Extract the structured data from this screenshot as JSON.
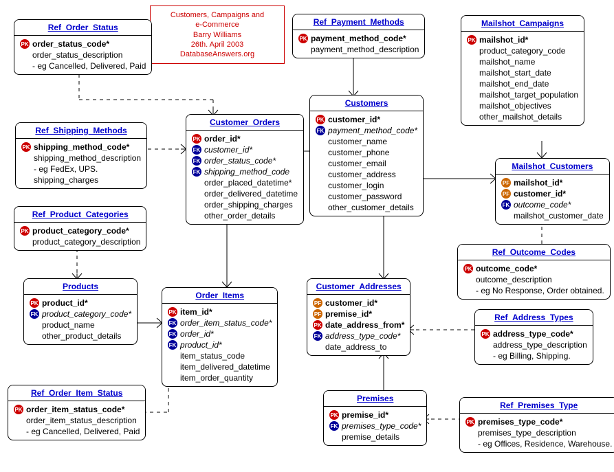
{
  "title": {
    "line1": "Customers, Campaigns and",
    "line2": "e-Commerce",
    "line3": "Barry Williams",
    "line4": "26th. April 2003",
    "line5": "DatabaseAnswers.org"
  },
  "entities": {
    "ref_order_status": {
      "name": "Ref_Order_Status",
      "fields": [
        {
          "key": "pk",
          "name": "order_status_code*",
          "b": true
        },
        {
          "key": "",
          "name": "order_status_description"
        },
        {
          "key": "",
          "name": "- eg Cancelled, Delivered, Paid"
        }
      ]
    },
    "ref_payment_methods": {
      "name": "Ref_Payment_Methods",
      "fields": [
        {
          "key": "pk",
          "name": "payment_method_code*",
          "b": true
        },
        {
          "key": "",
          "name": "payment_method_description"
        }
      ]
    },
    "mailshot_campaigns": {
      "name": "Mailshot_Campaigns",
      "fields": [
        {
          "key": "pk",
          "name": "mailshot_id*",
          "b": true
        },
        {
          "key": "",
          "name": "product_category_code"
        },
        {
          "key": "",
          "name": "mailshot_name"
        },
        {
          "key": "",
          "name": "mailshot_start_date"
        },
        {
          "key": "",
          "name": "mailshot_end_date"
        },
        {
          "key": "",
          "name": "mailshot_target_population"
        },
        {
          "key": "",
          "name": "mailshot_objectives"
        },
        {
          "key": "",
          "name": "other_mailshot_details"
        }
      ]
    },
    "ref_shipping_methods": {
      "name": "Ref_Shipping_Methods",
      "fields": [
        {
          "key": "pk",
          "name": "shipping_method_code*",
          "b": true
        },
        {
          "key": "",
          "name": "shipping_method_description"
        },
        {
          "key": "",
          "name": "- eg FedEx, UPS."
        },
        {
          "key": "",
          "name": "shipping_charges"
        }
      ]
    },
    "customer_orders": {
      "name": "Customer_Orders",
      "fields": [
        {
          "key": "pk",
          "name": "order_id*",
          "b": true
        },
        {
          "key": "fk",
          "name": "customer_id*",
          "i": true
        },
        {
          "key": "fk",
          "name": "order_status_code*",
          "i": true
        },
        {
          "key": "fk",
          "name": "shipping_method_code",
          "i": true
        },
        {
          "key": "",
          "name": "order_placed_datetime*"
        },
        {
          "key": "",
          "name": "order_delivered_datetime"
        },
        {
          "key": "",
          "name": "order_shipping_charges"
        },
        {
          "key": "",
          "name": "other_order_details"
        }
      ]
    },
    "customers": {
      "name": "Customers",
      "fields": [
        {
          "key": "pk",
          "name": "customer_id*",
          "b": true
        },
        {
          "key": "fk",
          "name": "payment_method_code*",
          "i": true
        },
        {
          "key": "",
          "name": "customer_name"
        },
        {
          "key": "",
          "name": "customer_phone"
        },
        {
          "key": "",
          "name": "customer_email"
        },
        {
          "key": "",
          "name": "customer_address"
        },
        {
          "key": "",
          "name": "customer_login"
        },
        {
          "key": "",
          "name": "customer_password"
        },
        {
          "key": "",
          "name": "other_customer_details"
        }
      ]
    },
    "mailshot_customers": {
      "name": "Mailshot_Customers",
      "fields": [
        {
          "key": "pfk",
          "name": "mailshot_id*",
          "b": true
        },
        {
          "key": "pfk",
          "name": "customer_id*",
          "b": true
        },
        {
          "key": "fk",
          "name": "outcome_code*",
          "i": true
        },
        {
          "key": "",
          "name": "mailshot_customer_date"
        }
      ]
    },
    "ref_product_categories": {
      "name": "Ref_Product_Categories",
      "fields": [
        {
          "key": "pk",
          "name": "product_category_code*",
          "b": true
        },
        {
          "key": "",
          "name": "product_category_description"
        }
      ]
    },
    "ref_outcome_codes": {
      "name": "Ref_Outcome_Codes",
      "fields": [
        {
          "key": "pk",
          "name": "outcome_code*",
          "b": true
        },
        {
          "key": "",
          "name": "outcome_description"
        },
        {
          "key": "",
          "name": "- eg No Response, Order obtained."
        }
      ]
    },
    "products": {
      "name": "Products",
      "fields": [
        {
          "key": "pk",
          "name": "product_id*",
          "b": true
        },
        {
          "key": "fk",
          "name": "product_category_code*",
          "i": true
        },
        {
          "key": "",
          "name": "product_name"
        },
        {
          "key": "",
          "name": "other_product_details"
        }
      ]
    },
    "order_items": {
      "name": "Order_Items",
      "fields": [
        {
          "key": "pk",
          "name": "item_id*",
          "b": true
        },
        {
          "key": "fk",
          "name": "order_item_status_code*",
          "i": true
        },
        {
          "key": "fk",
          "name": "order_id*",
          "i": true
        },
        {
          "key": "fk",
          "name": "product_id*",
          "i": true
        },
        {
          "key": "",
          "name": "item_status_code"
        },
        {
          "key": "",
          "name": "item_delivered_datetime"
        },
        {
          "key": "",
          "name": "item_order_quantity"
        }
      ]
    },
    "customer_addresses": {
      "name": "Customer_Addresses",
      "fields": [
        {
          "key": "pfk",
          "name": "customer_id*",
          "b": true
        },
        {
          "key": "pfk",
          "name": "premise_id*",
          "b": true
        },
        {
          "key": "pk",
          "name": "date_address_from*",
          "b": true
        },
        {
          "key": "fk",
          "name": "address_type_code*",
          "i": true
        },
        {
          "key": "",
          "name": "date_address_to"
        }
      ]
    },
    "ref_address_types": {
      "name": "Ref_Address_Types",
      "fields": [
        {
          "key": "pk",
          "name": "address_type_code*",
          "b": true
        },
        {
          "key": "",
          "name": "address_type_description"
        },
        {
          "key": "",
          "name": "- eg Billing, Shipping."
        }
      ]
    },
    "ref_order_item_status": {
      "name": "Ref_Order_Item_Status",
      "fields": [
        {
          "key": "pk",
          "name": "order_item_status_code*",
          "b": true
        },
        {
          "key": "",
          "name": "order_item_status_description"
        },
        {
          "key": "",
          "name": "- eg Cancelled, Delivered, Paid"
        }
      ]
    },
    "premises": {
      "name": "Premises",
      "fields": [
        {
          "key": "pk",
          "name": "premise_id*",
          "b": true
        },
        {
          "key": "fk",
          "name": "premises_type_code*",
          "i": true
        },
        {
          "key": "",
          "name": "premise_details"
        }
      ]
    },
    "ref_premises_type": {
      "name": "Ref_Premises_Type",
      "fields": [
        {
          "key": "pk",
          "name": "premises_type_code*",
          "b": true
        },
        {
          "key": "",
          "name": "premises_type_description"
        },
        {
          "key": "",
          "name": "- eg Offices, Residence, Warehouse."
        }
      ]
    }
  }
}
